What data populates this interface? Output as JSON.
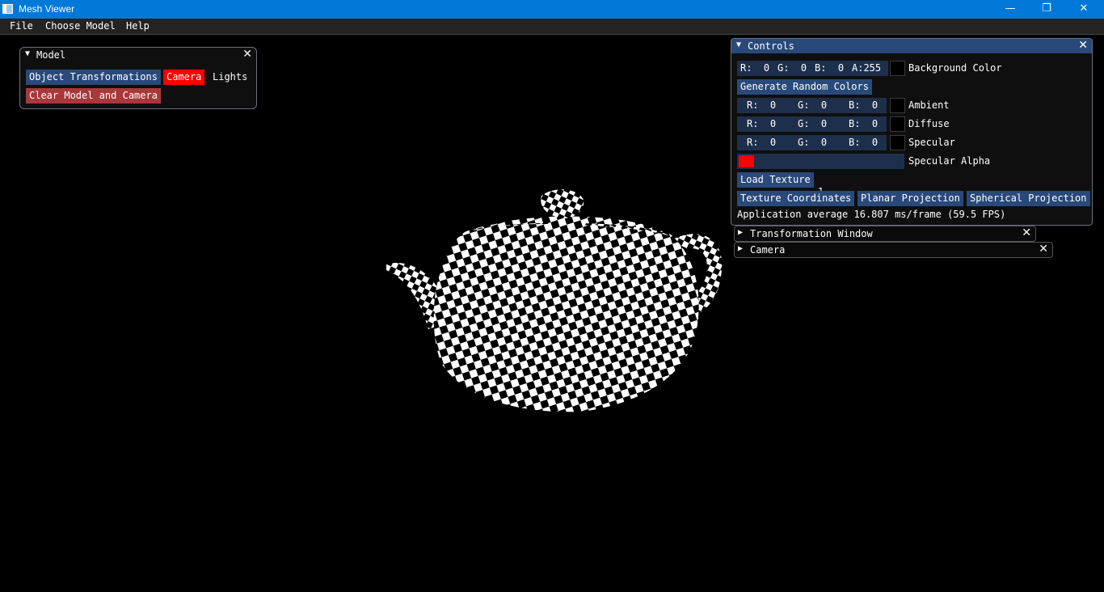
{
  "window": {
    "title": "Mesh Viewer",
    "minimize": "—",
    "maximize": "❐",
    "close": "✕"
  },
  "menu": [
    "File",
    "Choose Model",
    "Help"
  ],
  "model_window": {
    "title": "Model",
    "close": "✕",
    "object_transformations": "Object Transformations",
    "camera": "Camera",
    "lights": "Lights",
    "clear": "Clear Model and Camera"
  },
  "controls": {
    "title": "Controls",
    "close": "✕",
    "background": {
      "r": "R:  0",
      "g": "G:  0",
      "b": "B:  0",
      "a": "A:255",
      "label": "Background Color"
    },
    "generate_random": "Generate Random Colors",
    "ambient": {
      "r": "R:  0",
      "g": "G:  0",
      "b": "B:  0",
      "label": "Ambient"
    },
    "diffuse": {
      "r": "R:  0",
      "g": "G:  0",
      "b": "B:  0",
      "label": "Diffuse"
    },
    "specular": {
      "r": "R:  0",
      "g": "G:  0",
      "b": "B:  0",
      "label": "Specular"
    },
    "specular_alpha": {
      "value": "1",
      "label": "Specular Alpha"
    },
    "load_texture": "Load Texture",
    "texture_coordinates": "Texture Coordinates",
    "planar_projection": "Planar Projection",
    "spherical_projection": "Spherical Projection",
    "fps_text": "Application average 16.807 ms/frame (59.5 FPS)"
  },
  "transformation_window": {
    "title": "Transformation Window",
    "close": "✕"
  },
  "camera_window": {
    "title": "Camera",
    "close": "✕"
  },
  "icons": {
    "collapse": "▼",
    "expand": "▶"
  },
  "colors": {
    "accent_button": "#29497a",
    "active_red": "#ff0000",
    "clear_button": "#a8383b",
    "titlebar": "#0078d7"
  }
}
